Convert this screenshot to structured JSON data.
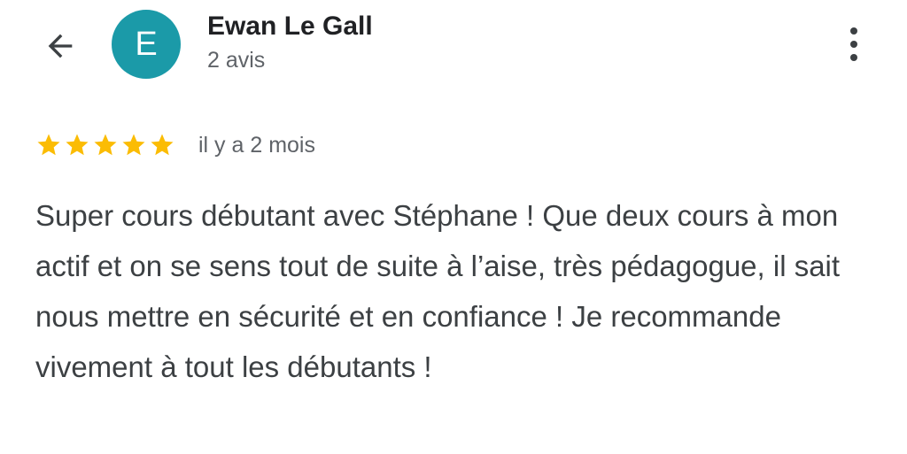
{
  "header": {
    "back_icon": "arrow-back-icon",
    "more_icon": "more-vert-icon"
  },
  "user": {
    "avatar_letter": "E",
    "avatar_color": "#1b9aa8",
    "name": "Ewan Le Gall",
    "reviews_count": "2 avis"
  },
  "review": {
    "rating": 5,
    "max_rating": 5,
    "star_color": "#fbbc04",
    "time_ago": "il y a 2 mois",
    "text": "Super cours débutant avec Stéphane ! Que deux cours à mon actif et on se sens tout de suite à l’aise, très pédagogue, il sait nous mettre en sécurité et en confiance ! Je recommande vivement à tout les débutants !"
  }
}
